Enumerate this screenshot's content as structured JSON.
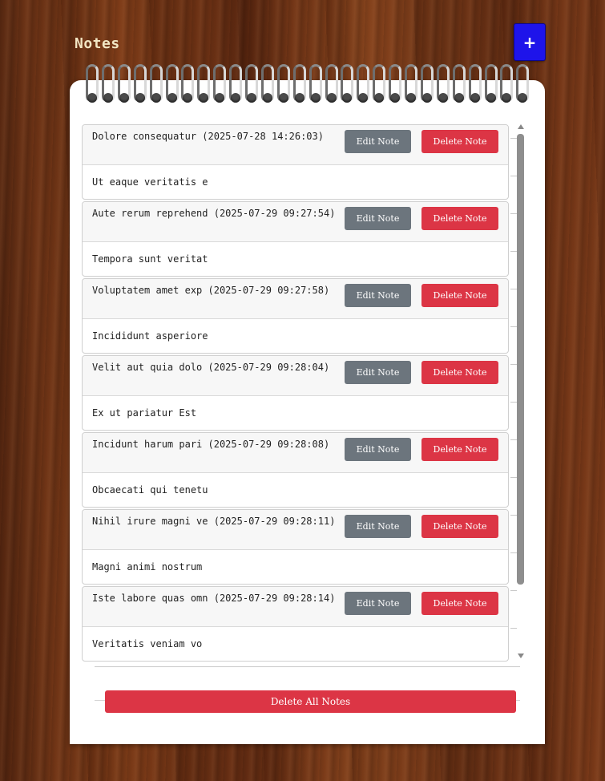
{
  "app": {
    "title": "Notes",
    "add_label": "+"
  },
  "notes": [
    {
      "title": "Dolore consequatur (2025-07-28 14:26:03)",
      "body": "Ut eaque veritatis e",
      "edit_label": "Edit Note",
      "delete_label": "Delete Note"
    },
    {
      "title": "Aute rerum reprehend (2025-07-29 09:27:54)",
      "body": "Tempora sunt veritat",
      "edit_label": "Edit Note",
      "delete_label": "Delete Note"
    },
    {
      "title": "Voluptatem amet exp (2025-07-29 09:27:58)",
      "body": "Incididunt asperiore",
      "edit_label": "Edit Note",
      "delete_label": "Delete Note"
    },
    {
      "title": "Velit aut quia dolo (2025-07-29 09:28:04)",
      "body": "Ex ut pariatur Est",
      "edit_label": "Edit Note",
      "delete_label": "Delete Note"
    },
    {
      "title": "Incidunt harum pari (2025-07-29 09:28:08)",
      "body": "Obcaecati qui tenetu",
      "edit_label": "Edit Note",
      "delete_label": "Delete Note"
    },
    {
      "title": "Nihil irure magni ve (2025-07-29 09:28:11)",
      "body": "Magni animi nostrum",
      "edit_label": "Edit Note",
      "delete_label": "Delete Note"
    },
    {
      "title": "Iste labore quas omn (2025-07-29 09:28:14)",
      "body": "Veritatis veniam vo",
      "edit_label": "Edit Note",
      "delete_label": "Delete Note"
    }
  ],
  "footer": {
    "delete_all_label": "Delete All Notes"
  },
  "colors": {
    "accent": "#1e14ea",
    "danger": "#dc3545",
    "secondary": "#6c757d",
    "paper": "#ffffff"
  }
}
